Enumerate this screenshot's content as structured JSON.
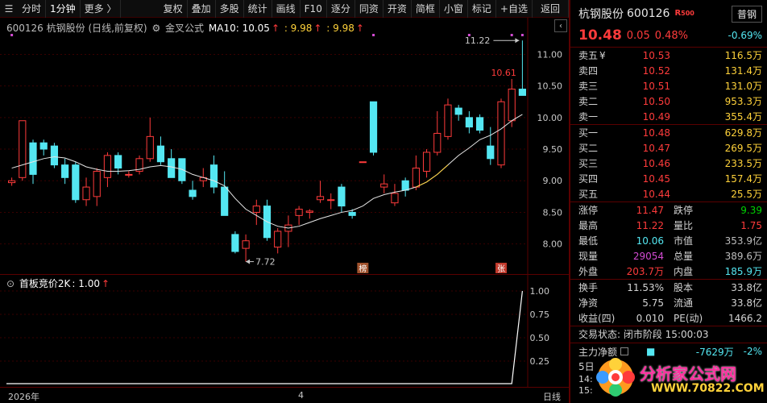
{
  "toolbar": {
    "menu_icon": "☰",
    "items": [
      "分时",
      "1分钟",
      "更多 〉",
      "复权",
      "叠加",
      "多股",
      "统计",
      "画线",
      "F10",
      "逐分",
      "同资",
      "开资",
      "简框",
      "小窗",
      "标记",
      "+自选",
      "返回"
    ],
    "selected": "1分钟"
  },
  "main_legend": {
    "stock": "600126 杭钢股份 (日线,前复权)",
    "indicator": "金叉公式",
    "ma_label": "MA10: 10.05",
    "ma_arrow": "↑",
    "v2": ": 9.98",
    "v3": ": 9.98"
  },
  "y_axis_main": [
    "11.00",
    "10.50",
    "10.00",
    "9.50",
    "9.00",
    "8.50",
    "8.00"
  ],
  "price_annotations": {
    "high_label": "11.22",
    "last_high": "10.61",
    "low_label": "7.72"
  },
  "event_markers": [
    "榜",
    "张"
  ],
  "sub_legend": {
    "name": "首板竞价2K",
    "value": ": 1.00",
    "arrow": "↑"
  },
  "y_axis_sub": [
    "1.00",
    "0.75",
    "0.50",
    "0.25"
  ],
  "x_axis": {
    "labels": [
      "2026年",
      "4"
    ],
    "period": "日线"
  },
  "colors": {
    "up": "#ff3b3b",
    "down": "#54e7f2",
    "ma": "#e6e6e6",
    "grid": "#3a0000",
    "dot": "#d24bd2"
  },
  "chart_data": {
    "type": "candlestick",
    "candles": [
      [
        8.97,
        9.05,
        8.92,
        9.0
      ],
      [
        9.05,
        9.95,
        9.0,
        9.95
      ],
      [
        9.6,
        9.65,
        8.95,
        9.1
      ],
      [
        9.6,
        9.65,
        9.4,
        9.5
      ],
      [
        9.55,
        9.6,
        9.2,
        9.25
      ],
      [
        9.25,
        9.35,
        8.95,
        9.05
      ],
      [
        9.25,
        9.3,
        8.65,
        8.7
      ],
      [
        8.7,
        9.05,
        8.6,
        8.9
      ],
      [
        8.75,
        9.2,
        8.6,
        9.15
      ],
      [
        9.05,
        9.45,
        8.9,
        9.4
      ],
      [
        9.4,
        9.45,
        9.1,
        9.2
      ],
      [
        9.1,
        9.15,
        9.05,
        9.1
      ],
      [
        9.15,
        9.4,
        9.1,
        9.35
      ],
      [
        9.35,
        10.0,
        9.3,
        9.7
      ],
      [
        9.55,
        9.7,
        9.25,
        9.3
      ],
      [
        9.35,
        9.5,
        9.05,
        9.05
      ],
      [
        9.35,
        9.35,
        8.95,
        9.0
      ],
      [
        8.85,
        9.0,
        8.7,
        8.75
      ],
      [
        9.0,
        9.2,
        8.9,
        9.05
      ],
      [
        9.25,
        9.4,
        8.8,
        8.9
      ],
      [
        8.9,
        9.15,
        8.45,
        8.45
      ],
      [
        8.15,
        8.2,
        7.85,
        7.88
      ],
      [
        7.93,
        8.15,
        7.72,
        8.05
      ],
      [
        8.5,
        8.7,
        8.3,
        8.6
      ],
      [
        8.6,
        8.7,
        8.05,
        8.1
      ],
      [
        7.95,
        8.25,
        7.85,
        8.2
      ],
      [
        8.2,
        8.45,
        7.95,
        8.3
      ],
      [
        8.45,
        8.6,
        8.3,
        8.55
      ],
      [
        8.5,
        8.55,
        8.4,
        8.52
      ],
      [
        8.7,
        9.0,
        8.65,
        8.75
      ],
      [
        8.7,
        8.8,
        8.55,
        8.7
      ],
      [
        8.9,
        8.95,
        8.5,
        8.6
      ],
      [
        8.5,
        8.55,
        8.4,
        8.45
      ],
      [
        9.3,
        9.3,
        9.3,
        9.3
      ],
      [
        10.25,
        10.25,
        9.4,
        9.45
      ],
      [
        8.9,
        9.1,
        8.8,
        8.95
      ],
      [
        8.65,
        8.95,
        8.6,
        8.8
      ],
      [
        9.0,
        9.05,
        8.75,
        8.85
      ],
      [
        8.9,
        9.4,
        8.85,
        9.2
      ],
      [
        9.15,
        9.5,
        9.05,
        9.45
      ],
      [
        9.45,
        10.1,
        9.4,
        9.75
      ],
      [
        9.7,
        10.3,
        9.65,
        10.2
      ],
      [
        10.15,
        10.2,
        9.95,
        10.05
      ],
      [
        10.0,
        10.1,
        9.75,
        9.85
      ],
      [
        10.0,
        10.05,
        9.75,
        9.8
      ],
      [
        9.55,
        9.85,
        9.25,
        9.35
      ],
      [
        9.25,
        10.3,
        9.2,
        10.25
      ],
      [
        9.95,
        10.61,
        9.85,
        10.45
      ],
      [
        10.45,
        11.22,
        10.35,
        10.35
      ]
    ],
    "ma10": [
      9.2,
      9.25,
      9.3,
      9.35,
      9.38,
      9.36,
      9.3,
      9.22,
      9.18,
      9.15,
      9.15,
      9.16,
      9.18,
      9.22,
      9.24,
      9.22,
      9.18,
      9.1,
      9.05,
      9.0,
      8.92,
      8.72,
      8.55,
      8.45,
      8.35,
      8.28,
      8.25,
      8.28,
      8.34,
      8.4,
      8.45,
      8.5,
      8.53,
      8.6,
      8.72,
      8.78,
      8.82,
      8.85,
      8.9,
      8.98,
      9.1,
      9.25,
      9.4,
      9.52,
      9.65,
      9.72,
      9.82,
      9.95,
      10.05
    ],
    "ylim": [
      7.6,
      11.35
    ],
    "sub_indicator": {
      "name": "首板竞价2K",
      "values_flat": 0.0,
      "final": 1.0
    }
  },
  "quote": {
    "name": "杭钢股份",
    "code": "600126",
    "r_badge": "R",
    "r_num": "500",
    "tab_label": "普钢",
    "price": "10.48",
    "change": "0.05",
    "pct": "0.48%",
    "tab_pct": "-0.69%",
    "asks": [
      {
        "label": "卖五",
        "sym": "¥",
        "price": "10.53",
        "vol": "116.5万"
      },
      {
        "label": "卖四",
        "sym": "",
        "price": "10.52",
        "vol": "131.4万"
      },
      {
        "label": "卖三",
        "sym": "",
        "price": "10.51",
        "vol": "131.0万"
      },
      {
        "label": "卖二",
        "sym": "",
        "price": "10.50",
        "vol": "953.3万"
      },
      {
        "label": "卖一",
        "sym": "",
        "price": "10.49",
        "vol": "355.4万"
      }
    ],
    "bids": [
      {
        "label": "买一",
        "price": "10.48",
        "vol": "629.8万"
      },
      {
        "label": "买二",
        "price": "10.47",
        "vol": "269.5万"
      },
      {
        "label": "买三",
        "price": "10.46",
        "vol": "233.5万"
      },
      {
        "label": "买四",
        "price": "10.45",
        "vol": "157.4万"
      },
      {
        "label": "买五",
        "price": "10.44",
        "vol": "25.5万"
      }
    ],
    "stats1": [
      {
        "k": "涨停",
        "v": "11.47",
        "vc": "red",
        "k2": "跌停",
        "v2": "9.39",
        "v2c": "green"
      },
      {
        "k": "最高",
        "v": "11.22",
        "vc": "red",
        "k2": "量比",
        "v2": "1.75",
        "v2c": "red"
      },
      {
        "k": "最低",
        "v": "10.06",
        "vc": "cyan",
        "k2": "市值",
        "v2": "353.9亿",
        "v2c": "grey"
      },
      {
        "k": "现量",
        "v": "29054",
        "vc": "purple",
        "k2": "总量",
        "v2": "389.6万",
        "v2c": "grey"
      },
      {
        "k": "外盘",
        "v": "203.7万",
        "vc": "red",
        "k2": "内盘",
        "v2": "185.9万",
        "v2c": "cyan"
      }
    ],
    "stats2": [
      {
        "k": "换手",
        "v": "11.53%",
        "k2": "股本",
        "v2": "33.8亿"
      },
      {
        "k": "净资",
        "v": "5.75",
        "k2": "流通",
        "v2": "33.8亿"
      },
      {
        "k": "收益(四)",
        "v": "0.010",
        "k2": "PE(动)",
        "v2": "1466.2"
      }
    ],
    "trade_status": "交易状态: 闭市阶段 15:00:03",
    "main_flow_label": "主力净额",
    "main_flow_value": "-7629万",
    "main_flow_pct": "-2%",
    "day5": "5日",
    "time1": "14:",
    "time2": "15:"
  },
  "logo": {
    "text": "分析家公式网",
    "url": "WWW.70822.COM"
  }
}
